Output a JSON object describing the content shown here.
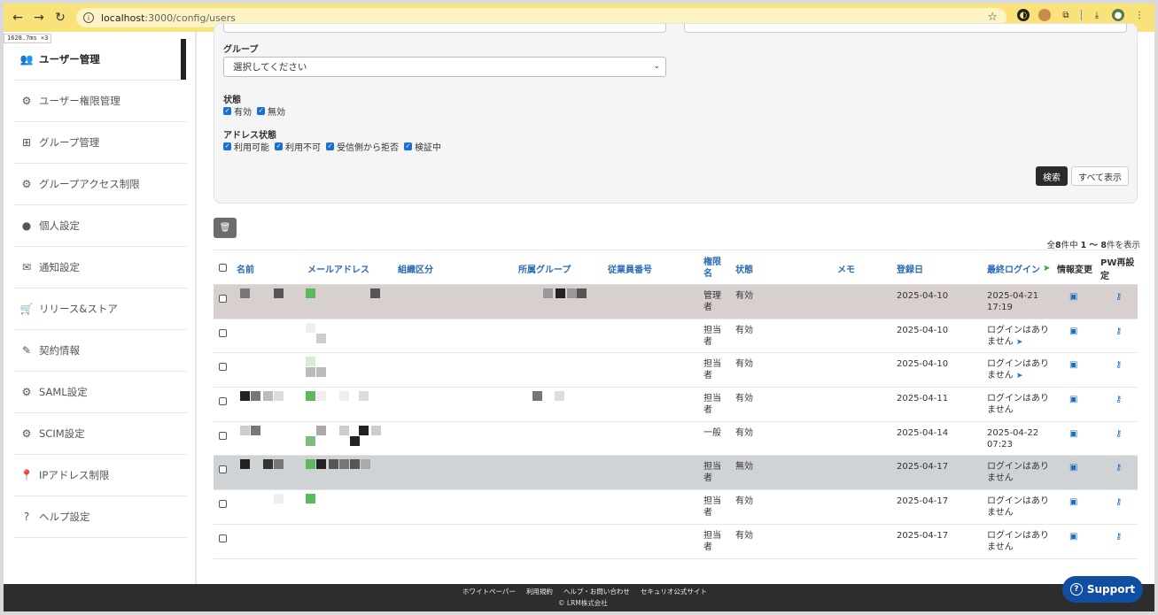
{
  "browser": {
    "url_host": "localhost",
    "url_path": ":3000/config/users"
  },
  "timing_overlay": "1628.7ms ×3",
  "sidebar": {
    "items": [
      {
        "label": "ユーザー管理",
        "icon": "users-icon"
      },
      {
        "label": "ユーザー権限管理",
        "icon": "gear-icon"
      },
      {
        "label": "グループ管理",
        "icon": "sitemap-icon"
      },
      {
        "label": "グループアクセス制限",
        "icon": "gear-icon"
      },
      {
        "label": "個人設定",
        "icon": "user-icon"
      },
      {
        "label": "通知設定",
        "icon": "envelope-icon"
      },
      {
        "label": "リリース&ストア",
        "icon": "cart-icon"
      },
      {
        "label": "契約情報",
        "icon": "contract-icon"
      },
      {
        "label": "SAML設定",
        "icon": "gears-icon"
      },
      {
        "label": "SCIM設定",
        "icon": "users-gear-icon"
      },
      {
        "label": "IPアドレス制限",
        "icon": "map-pin-icon"
      },
      {
        "label": "ヘルプ設定",
        "icon": "question-icon"
      }
    ]
  },
  "filters": {
    "group_label": "グループ",
    "group_select_value": "選択してください",
    "status_label": "状態",
    "status_options": [
      "有効",
      "無効"
    ],
    "address_status_label": "アドレス状態",
    "address_options": [
      "利用可能",
      "利用不可",
      "受信側から拒否",
      "検証中"
    ],
    "search_button": "検索",
    "show_all_button": "すべて表示"
  },
  "result_count": {
    "prefix": "全",
    "total": "8",
    "mid": "件中 ",
    "range": "1 〜 8",
    "suffix": "件を表示"
  },
  "table": {
    "headers": {
      "name": "名前",
      "email": "メールアドレス",
      "org_division": "組織区分",
      "group": "所属グループ",
      "employee_no": "従業員番号",
      "role": "権限名",
      "status": "状態",
      "memo": "メモ",
      "registered": "登録日",
      "last_login": "最終ログイン",
      "info_change": "情報変更",
      "pw_reset": "PW再設定"
    },
    "rows": [
      {
        "role": "管理者",
        "status": "有効",
        "registered": "2025-04-10",
        "last_login": "2025-04-21 17:19",
        "send": false
      },
      {
        "role": "担当者",
        "status": "有効",
        "registered": "2025-04-10",
        "last_login": "ログインはありません",
        "send": true
      },
      {
        "role": "担当者",
        "status": "有効",
        "registered": "2025-04-10",
        "last_login": "ログインはありません",
        "send": true
      },
      {
        "role": "担当者",
        "status": "有効",
        "registered": "2025-04-11",
        "last_login": "ログインはありません",
        "send": false
      },
      {
        "role": "一般",
        "status": "有効",
        "registered": "2025-04-14",
        "last_login": "2025-04-22 07:23",
        "send": false
      },
      {
        "role": "担当者",
        "status": "無効",
        "registered": "2025-04-17",
        "last_login": "ログインはありません",
        "send": false
      },
      {
        "role": "担当者",
        "status": "有効",
        "registered": "2025-04-17",
        "last_login": "ログインはありません",
        "send": false
      },
      {
        "role": "担当者",
        "status": "有効",
        "registered": "2025-04-17",
        "last_login": "ログインはありません",
        "send": false
      }
    ]
  },
  "footer": {
    "links": [
      "ホワイトペーパー",
      "利用規約",
      "ヘルプ・お問い合わせ",
      "セキュリオ公式サイト"
    ],
    "copyright": "© LRM株式会社"
  },
  "support_button": "Support"
}
